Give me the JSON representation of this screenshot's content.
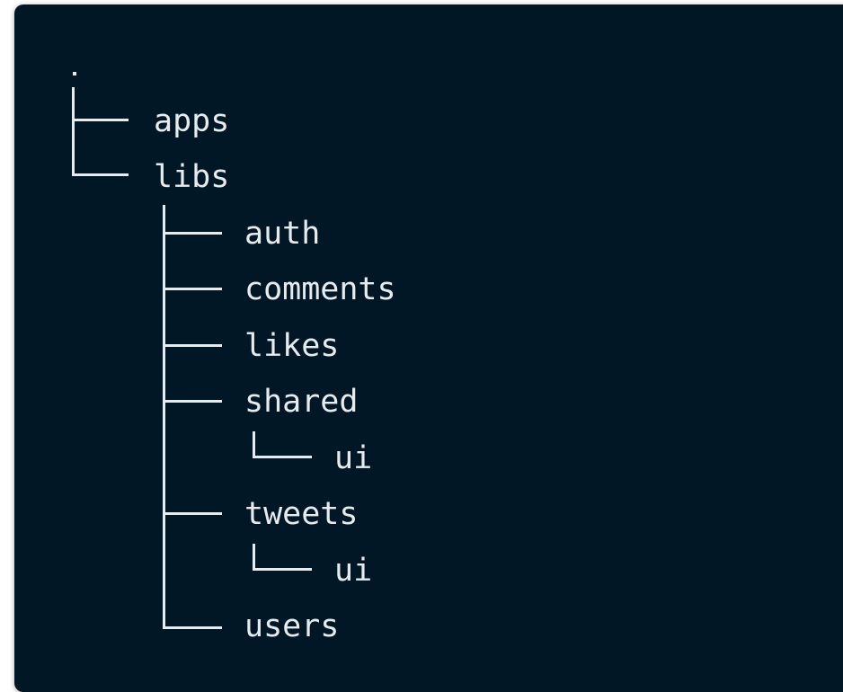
{
  "tree": {
    "root": ".",
    "items": {
      "apps": "apps",
      "libs": "libs",
      "auth": "auth",
      "comments": "comments",
      "likes": "likes",
      "shared": "shared",
      "shared_ui": "ui",
      "tweets": "tweets",
      "tweets_ui": "ui",
      "users": "users"
    }
  }
}
